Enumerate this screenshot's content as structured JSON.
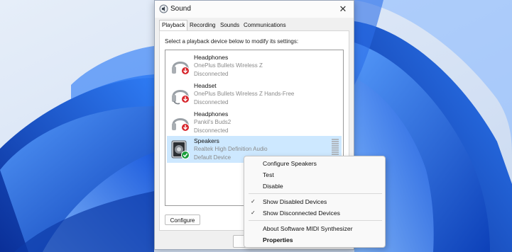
{
  "window": {
    "title": "Sound",
    "close_glyph": "✕"
  },
  "tabs": [
    {
      "label": "Playback",
      "active": true
    },
    {
      "label": "Recording",
      "active": false
    },
    {
      "label": "Sounds",
      "active": false
    },
    {
      "label": "Communications",
      "active": false
    }
  ],
  "instruction": "Select a playback device below to modify its settings:",
  "devices": [
    {
      "name": "Headphones",
      "description": "OnePlus Bullets Wireless Z",
      "status": "Disconnected",
      "icon": "headphones-icon",
      "badge": "down-arrow-red"
    },
    {
      "name": "Headset",
      "description": "OnePlus Bullets Wireless Z Hands-Free",
      "status": "Disconnected",
      "icon": "headset-icon",
      "badge": "down-arrow-red"
    },
    {
      "name": "Headphones",
      "description": "Pankil's Buds2",
      "status": "Disconnected",
      "icon": "headphones-icon",
      "badge": "down-arrow-red"
    },
    {
      "name": "Speakers",
      "description": "Realtek High Definition Audio",
      "status": "Default Device",
      "icon": "speaker-icon",
      "badge": "check-green",
      "selected": true
    }
  ],
  "buttons": {
    "configure": "Configure"
  },
  "context_menu": {
    "items": [
      {
        "label": "Configure Speakers",
        "checked": false
      },
      {
        "label": "Test",
        "checked": false
      },
      {
        "label": "Disable",
        "checked": false
      },
      {
        "label": "Show Disabled Devices",
        "checked": true
      },
      {
        "label": "Show Disconnected Devices",
        "checked": true
      },
      {
        "label": "About Software MIDI Synthesizer",
        "checked": false
      },
      {
        "label": "Properties",
        "checked": false,
        "bold": true
      }
    ],
    "check_glyph": "✓"
  },
  "colors": {
    "selection": "#cde8ff",
    "badge_red": "#d7262c",
    "badge_green": "#1a9e3c",
    "wallpaper_blue": "#1f5fd8"
  }
}
